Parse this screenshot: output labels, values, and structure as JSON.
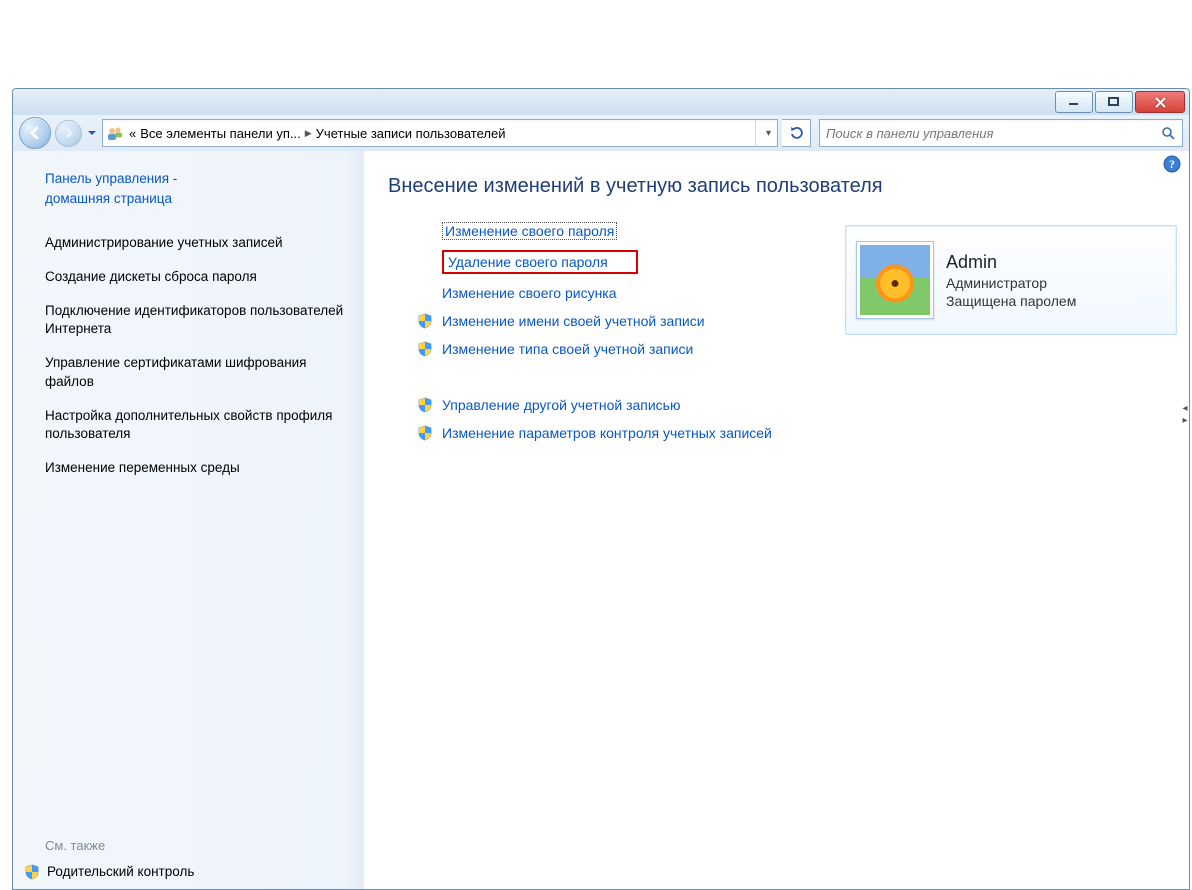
{
  "breadcrumb": {
    "overflow_glyph": "«",
    "parent": "Все элементы панели уп...",
    "sep": "▶",
    "current": "Учетные записи пользователей",
    "drop_glyph": "▾"
  },
  "search": {
    "placeholder": "Поиск в панели управления"
  },
  "sidebar": {
    "home_line1": "Панель управления -",
    "home_line2": "домашняя страница",
    "items": [
      "Администрирование учетных записей",
      "Создание дискеты сброса пароля",
      "Подключение идентификаторов пользователей Интернета",
      "Управление сертификатами шифрования файлов",
      "Настройка дополнительных свойств профиля пользователя",
      "Изменение переменных среды"
    ],
    "see_also_heading": "См. также",
    "see_also_item": "Родительский контроль"
  },
  "main": {
    "heading": "Внесение изменений в учетную запись пользователя",
    "tasks": [
      {
        "label": "Изменение своего пароля",
        "shield": false,
        "focus": true,
        "highlight": false
      },
      {
        "label": "Удаление своего пароля",
        "shield": false,
        "focus": false,
        "highlight": true
      },
      {
        "label": "Изменение своего рисунка",
        "shield": false,
        "focus": false,
        "highlight": false
      },
      {
        "label": "Изменение имени своей учетной записи",
        "shield": true,
        "focus": false,
        "highlight": false
      },
      {
        "label": "Изменение типа своей учетной записи",
        "shield": true,
        "focus": false,
        "highlight": false
      }
    ],
    "tasks2": [
      {
        "label": "Управление другой учетной записью",
        "shield": true
      },
      {
        "label": "Изменение параметров контроля учетных записей",
        "shield": true
      }
    ]
  },
  "user": {
    "name": "Admin",
    "role": "Администратор",
    "status": "Защищена паролем"
  }
}
